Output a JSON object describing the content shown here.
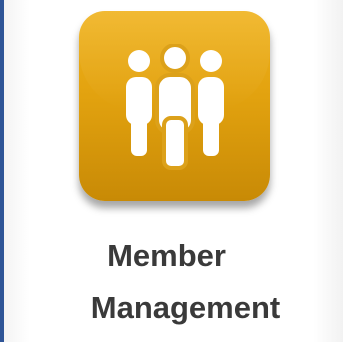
{
  "app_tile": {
    "icon": "group-users-icon",
    "label_line_1": "Member",
    "label_line_2": "Management",
    "colors": {
      "tile_top": "#f0b21c",
      "tile_bottom": "#c88a06",
      "icon": "#ffffff",
      "label": "#3a3a3a",
      "left_edge": "#2f5597"
    }
  }
}
